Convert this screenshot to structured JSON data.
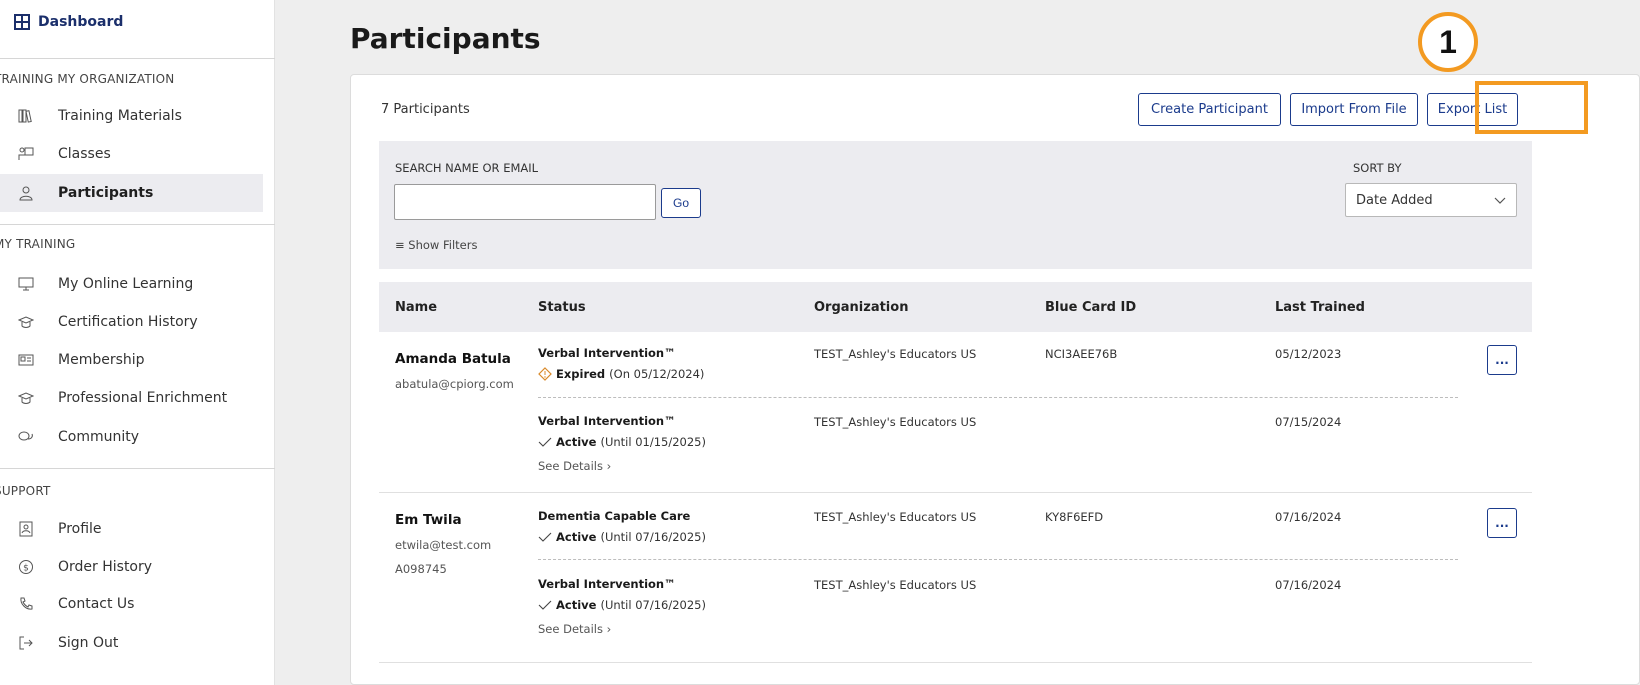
{
  "sidebar": {
    "dashboard_label": "Dashboard",
    "sections": [
      {
        "title": "TRAINING MY ORGANIZATION",
        "items": [
          {
            "label": "Training Materials",
            "icon": "books-icon"
          },
          {
            "label": "Classes",
            "icon": "classroom-icon"
          },
          {
            "label": "Participants",
            "icon": "person-icon",
            "active": true
          }
        ]
      },
      {
        "title": "MY TRAINING",
        "items": [
          {
            "label": "My Online Learning",
            "icon": "monitor-icon"
          },
          {
            "label": "Certification History",
            "icon": "graduation-cap-icon"
          },
          {
            "label": "Membership",
            "icon": "id-card-icon"
          },
          {
            "label": "Professional Enrichment",
            "icon": "graduation-cap-icon"
          },
          {
            "label": "Community",
            "icon": "chat-bubbles-icon"
          }
        ]
      },
      {
        "title": "SUPPORT",
        "items": [
          {
            "label": "Profile",
            "icon": "profile-icon"
          },
          {
            "label": "Order History",
            "icon": "dollar-circle-icon"
          },
          {
            "label": "Contact Us",
            "icon": "phone-icon"
          },
          {
            "label": "Sign Out",
            "icon": "sign-out-icon"
          }
        ]
      }
    ]
  },
  "page": {
    "title": "Participants"
  },
  "toolbar": {
    "count_label": "7 Participants",
    "create_label": "Create Participant",
    "import_label": "Import From File",
    "export_label": "Export List"
  },
  "annotation": {
    "step_number": "1",
    "color": "#f39a21"
  },
  "search": {
    "label": "SEARCH NAME OR EMAIL",
    "value": "",
    "go_label": "Go",
    "filters_label": "Show Filters",
    "sort_label": "SORT BY",
    "sort_value": "Date Added"
  },
  "table": {
    "headers": [
      "Name",
      "Status",
      "Organization",
      "Blue Card ID",
      "Last Trained"
    ],
    "rows": [
      {
        "name": "Amanda Batula",
        "email": "abatula@cpiorg.com",
        "extra": "",
        "certs": [
          {
            "name": "Verbal Intervention™",
            "state": "Expired",
            "detail": "(On 05/12/2024)",
            "org": "TEST_Ashley's Educators US",
            "blue_card": "NCI3AEE76B",
            "last_trained": "05/12/2023",
            "see_details": ""
          },
          {
            "name": "Verbal Intervention™",
            "state": "Active",
            "detail": "(Until 01/15/2025)",
            "org": "TEST_Ashley's Educators US",
            "blue_card": "",
            "last_trained": "07/15/2024",
            "see_details": "See Details"
          }
        ]
      },
      {
        "name": "Em Twila",
        "email": "etwila@test.com",
        "extra": "A098745",
        "certs": [
          {
            "name": "Dementia Capable Care",
            "state": "Active",
            "detail": "(Until 07/16/2025)",
            "org": "TEST_Ashley's Educators US",
            "blue_card": "KY8F6EFD",
            "last_trained": "07/16/2024",
            "see_details": ""
          },
          {
            "name": "Verbal Intervention™",
            "state": "Active",
            "detail": "(Until 07/16/2025)",
            "org": "TEST_Ashley's Educators US",
            "blue_card": "",
            "last_trained": "07/16/2024",
            "see_details": "See Details"
          }
        ]
      }
    ],
    "more_label": "..."
  },
  "colors": {
    "brand": "#1b3b8c",
    "highlight": "#f39a21",
    "expired": "#d98a2b"
  }
}
